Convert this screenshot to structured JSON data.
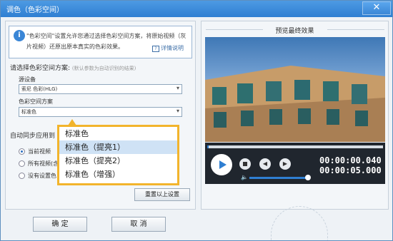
{
  "window": {
    "title": "调色（色彩空间）",
    "close_glyph": "✕"
  },
  "info": {
    "text": "\"色彩空间\"设置允许您通过选择色彩空间方案，将原始视频（灰片视频）还原出原本真实的色彩效果。",
    "help_icon_label": "?",
    "help_label": "详情说明"
  },
  "scheme": {
    "title": "请选择色彩空间方案:",
    "hint": "(默认参数为自动识别的结果)",
    "source_label": "源设备",
    "source_value": "索尼 色彩(HLG)",
    "space_label": "色彩空间方案",
    "space_value": "标准色",
    "options": [
      "标准色",
      "标准色（提亮1）",
      "标准色（提亮2）",
      "标准色（增强）"
    ],
    "selected_index": 1
  },
  "apply": {
    "title": "自动同步应用到",
    "radios": [
      "当前视频",
      "所有视频(含",
      "没有设置色"
    ],
    "selected_index": 0
  },
  "buttons": {
    "reset": "重置以上设置",
    "ok": "确 定",
    "cancel": "取 消"
  },
  "preview": {
    "title": "预览最终效果",
    "current_time": "00:00:00.040",
    "total_time": "00:00:05.000",
    "progress": 0.01,
    "volume": 1.0
  },
  "icons": {
    "info": "info-icon",
    "play": "play-icon",
    "stop": "stop-icon",
    "prev": "prev-frame-icon",
    "next": "next-frame-icon",
    "volume": "volume-icon"
  },
  "colors": {
    "accent": "#2f7fd2",
    "highlight": "#f2b42c"
  }
}
